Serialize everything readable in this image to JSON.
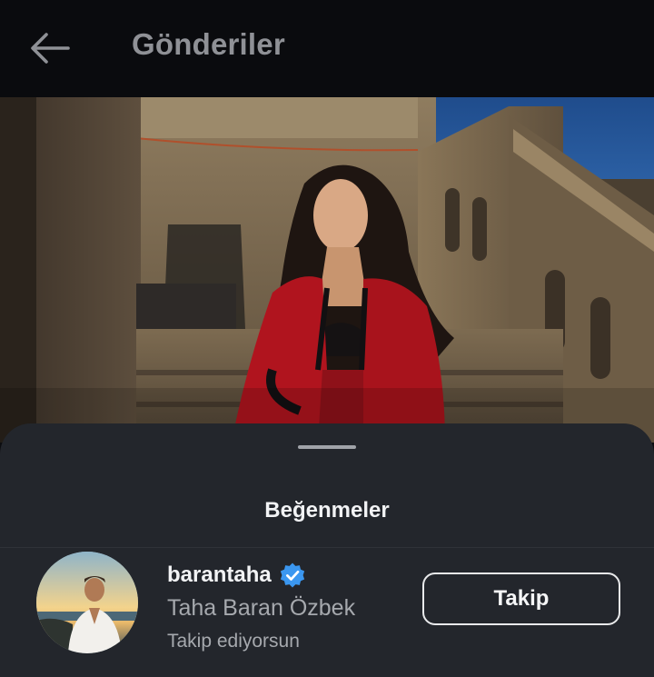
{
  "header": {
    "title": "Gönderiler",
    "back_icon": "arrow-left-icon"
  },
  "post": {
    "image": "photo of woman in red jacket sitting on stone steps"
  },
  "likes_sheet": {
    "title": "Beğenmeler",
    "users": [
      {
        "username": "barantaha",
        "verified": true,
        "full_name": "Taha Baran Özbek",
        "status": "Takip ediyorsun",
        "button_label": "Takip"
      }
    ]
  },
  "colors": {
    "background": "#0a0b0e",
    "sheet": "#23262c",
    "verified_badge": "#3b97f0",
    "title_gray": "#8f9196",
    "secondary_text": "#a6a9ae"
  }
}
